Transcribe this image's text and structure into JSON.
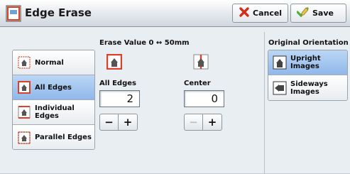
{
  "window": {
    "title": "Edge Erase"
  },
  "toolbar": {
    "cancel_label": "Cancel",
    "save_label": "Save"
  },
  "menu": {
    "items": [
      {
        "label": "Normal",
        "selected": false
      },
      {
        "label": "All Edges",
        "selected": true
      },
      {
        "label": "Individual Edges",
        "line1": "Individual",
        "line2": "Edges",
        "selected": false
      },
      {
        "label": "Parallel Edges",
        "selected": false
      }
    ]
  },
  "erase": {
    "range_label": "Erase Value 0 ↔ 50mm",
    "all_edges": {
      "label": "All Edges",
      "value": "2"
    },
    "center": {
      "label": "Center",
      "value": "0",
      "minus_enabled": false
    }
  },
  "orientation": {
    "label": "Original Orientation",
    "options": [
      {
        "label": "Upright Images",
        "selected": true
      },
      {
        "label": "Sideways Images",
        "line1": "Sideways",
        "line2": "Images",
        "selected": false
      }
    ]
  },
  "stepper": {
    "minus": "−",
    "plus": "+"
  },
  "colors": {
    "selected_bg": "#9fc3ee",
    "frame_red": "#d9412a",
    "accent_green": "#55b03a",
    "cancel_red": "#d32e1a"
  },
  "icons": [
    "edge-erase-app-icon",
    "cancel-x-icon",
    "save-check-icon",
    "doc-frame-icon",
    "upright-image-icon",
    "sideways-image-icon"
  ]
}
